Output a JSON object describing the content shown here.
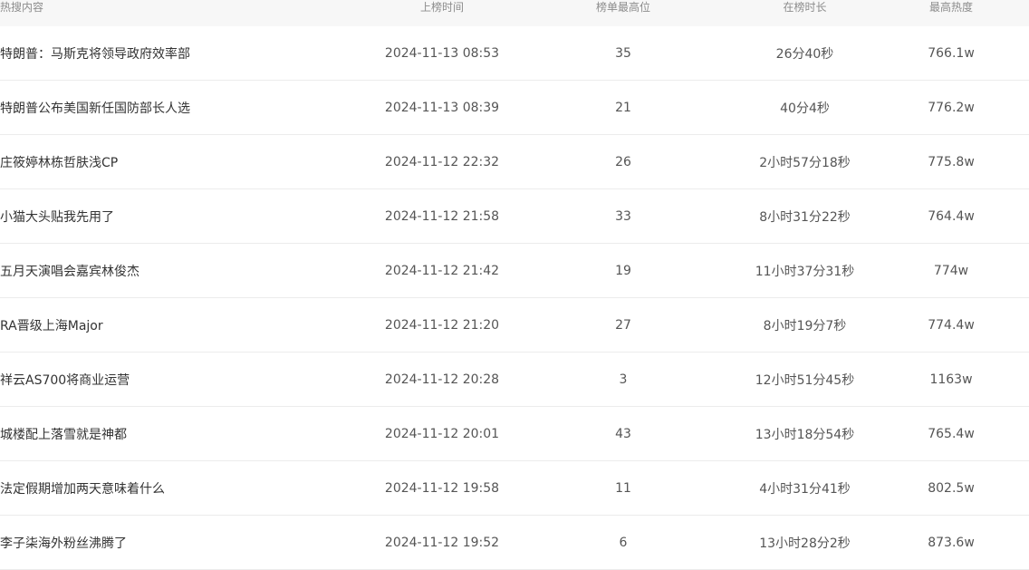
{
  "table": {
    "headers": {
      "title": "热搜内容",
      "time": "上榜时间",
      "rank": "榜单最高位",
      "duration": "在榜时长",
      "heat": "最高热度"
    },
    "rows": [
      {
        "title": "特朗普：马斯克将领导政府效率部",
        "time": "2024-11-13 08:53",
        "rank": "35",
        "duration": "26分40秒",
        "heat": "766.1w"
      },
      {
        "title": "特朗普公布美国新任国防部长人选",
        "time": "2024-11-13 08:39",
        "rank": "21",
        "duration": "40分4秒",
        "heat": "776.2w"
      },
      {
        "title": "庄筱婷林栋哲肤浅CP",
        "time": "2024-11-12 22:32",
        "rank": "26",
        "duration": "2小时57分18秒",
        "heat": "775.8w"
      },
      {
        "title": "小猫大头贴我先用了",
        "time": "2024-11-12 21:58",
        "rank": "33",
        "duration": "8小时31分22秒",
        "heat": "764.4w"
      },
      {
        "title": "五月天演唱会嘉宾林俊杰",
        "time": "2024-11-12 21:42",
        "rank": "19",
        "duration": "11小时37分31秒",
        "heat": "774w"
      },
      {
        "title": "RA晋级上海Major",
        "time": "2024-11-12 21:20",
        "rank": "27",
        "duration": "8小时19分7秒",
        "heat": "774.4w"
      },
      {
        "title": "祥云AS700将商业运营",
        "time": "2024-11-12 20:28",
        "rank": "3",
        "duration": "12小时51分45秒",
        "heat": "1163w"
      },
      {
        "title": "城楼配上落雪就是神都",
        "time": "2024-11-12 20:01",
        "rank": "43",
        "duration": "13小时18分54秒",
        "heat": "765.4w"
      },
      {
        "title": "法定假期增加两天意味着什么",
        "time": "2024-11-12 19:58",
        "rank": "11",
        "duration": "4小时31分41秒",
        "heat": "802.5w"
      },
      {
        "title": "李子柒海外粉丝沸腾了",
        "time": "2024-11-12 19:52",
        "rank": "6",
        "duration": "13小时28分2秒",
        "heat": "873.6w"
      }
    ]
  }
}
